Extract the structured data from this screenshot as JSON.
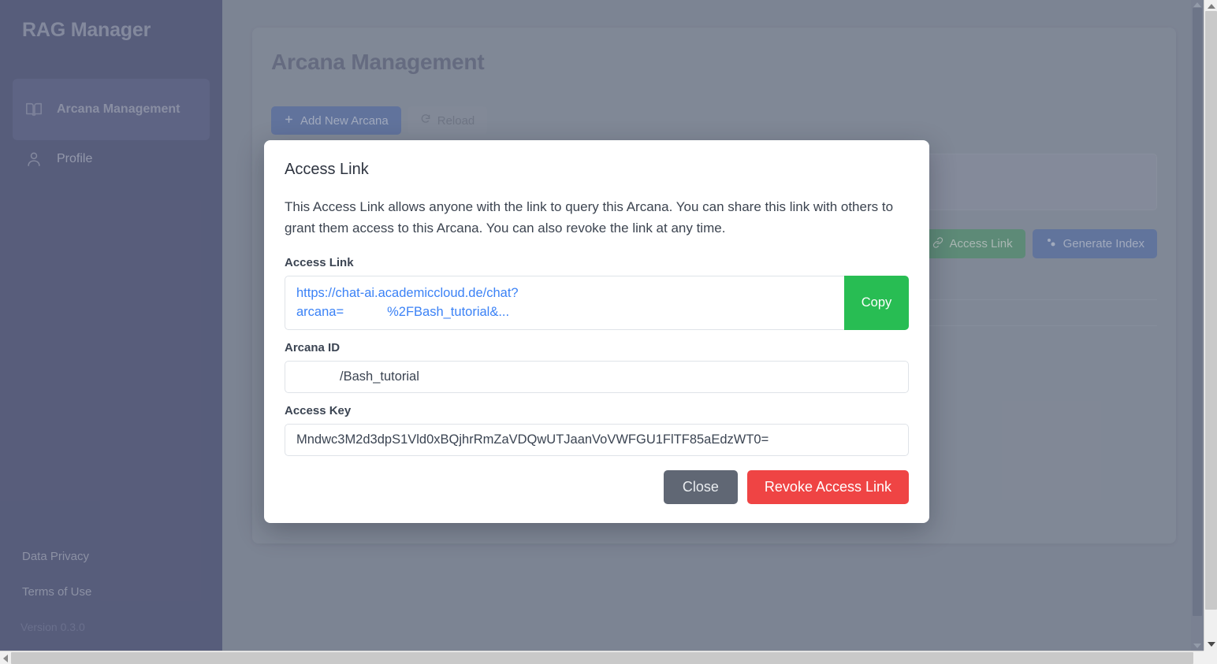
{
  "sidebar": {
    "brand": "RAG Manager",
    "items": [
      {
        "label": "Arcana Management",
        "icon": "book-open-icon",
        "active": true
      },
      {
        "label": "Profile",
        "icon": "user-icon",
        "active": false
      }
    ],
    "footer": {
      "data_privacy": "Data Privacy",
      "terms_of_use": "Terms of Use",
      "version": "Version 0.3.0"
    }
  },
  "main": {
    "page_title": "Arcana Management",
    "toolbar": {
      "add_new_arcana": "Add New Arcana",
      "add_icon": "plus-icon",
      "reload": "Reload",
      "reload_icon": "refresh-icon"
    },
    "row_actions": {
      "access_link": "Access Link",
      "access_link_icon": "link-icon",
      "generate_index": "Generate Index",
      "generate_index_icon": "cogs-icon"
    }
  },
  "modal": {
    "title": "Access Link",
    "description": "This Access Link allows anyone with the link to query this Arcana. You can share this link with others to grant them access to this Arcana. You can also revoke the link at any time.",
    "access_link": {
      "label": "Access Link",
      "value": "https://chat-ai.academiccloud.de/chat?\narcana=            %2FBash_tutorial&...",
      "copy_label": "Copy"
    },
    "arcana_id": {
      "label": "Arcana ID",
      "value": "            /Bash_tutorial"
    },
    "access_key": {
      "label": "Access Key",
      "value": "Mndwc3M2d3dpS1Vld0xBQjhrRmZaVDQwUTJaanVoVWFGU1FlTF85aEdzWT0="
    },
    "actions": {
      "close": "Close",
      "revoke": "Revoke Access Link"
    }
  },
  "colors": {
    "sidebar_bg": "#5f6485",
    "overlay_bg": "#8c94a3",
    "copy_green": "#28bd53",
    "revoke_red": "#ef4444",
    "close_gray": "#606774",
    "link_blue": "#3b82f6",
    "accent_blue": "#6b7fae"
  }
}
